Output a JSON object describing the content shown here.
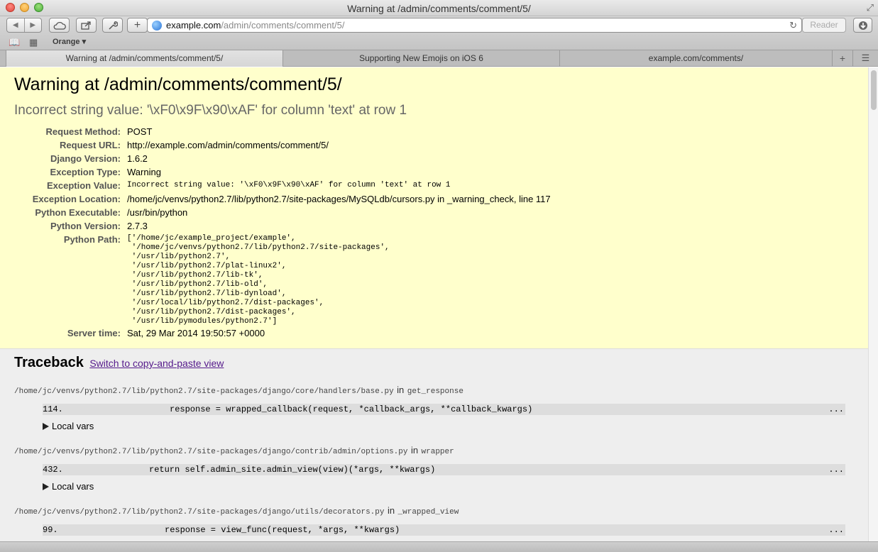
{
  "window": {
    "title": "Warning at /admin/comments/comment/5/"
  },
  "toolbar": {
    "url_host": "example.com",
    "url_path": "/admin/comments/comment/5/",
    "reader_label": "Reader"
  },
  "bookmarks": {
    "folder_label": "Orange ▾"
  },
  "tabs": [
    {
      "label": "Warning at /admin/comments/comment/5/",
      "active": true
    },
    {
      "label": "Supporting New Emojis on iOS 6",
      "active": false
    },
    {
      "label": "example.com/comments/",
      "active": false
    }
  ],
  "summary": {
    "title": "Warning at /admin/comments/comment/5/",
    "subtitle": "Incorrect string value: '\\xF0\\x9F\\x90\\xAF' for column 'text' at row 1",
    "rows": [
      {
        "label": "Request Method:",
        "value": "POST"
      },
      {
        "label": "Request URL:",
        "value": "http://example.com/admin/comments/comment/5/"
      },
      {
        "label": "Django Version:",
        "value": "1.6.2"
      },
      {
        "label": "Exception Type:",
        "value": "Warning"
      },
      {
        "label": "Exception Value:",
        "value": "Incorrect string value: '\\xF0\\x9F\\x90\\xAF' for column 'text' at row 1"
      },
      {
        "label": "Exception Location:",
        "value": "/home/jc/venvs/python2.7/lib/python2.7/site-packages/MySQLdb/cursors.py in _warning_check, line 117"
      },
      {
        "label": "Python Executable:",
        "value": "/usr/bin/python"
      },
      {
        "label": "Python Version:",
        "value": "2.7.3"
      }
    ],
    "python_path_label": "Python Path:",
    "python_path": [
      "['/home/jc/example_project/example',",
      " '/home/jc/venvs/python2.7/lib/python2.7/site-packages',",
      " '/usr/lib/python2.7',",
      " '/usr/lib/python2.7/plat-linux2',",
      " '/usr/lib/python2.7/lib-tk',",
      " '/usr/lib/python2.7/lib-old',",
      " '/usr/lib/python2.7/lib-dynload',",
      " '/usr/local/lib/python2.7/dist-packages',",
      " '/usr/lib/python2.7/dist-packages',",
      " '/usr/lib/pymodules/python2.7']"
    ],
    "server_time_label": "Server time:",
    "server_time": "Sat, 29 Mar 2014 19:50:57 +0000"
  },
  "traceback": {
    "title": "Traceback",
    "switch_link": "Switch to copy-and-paste view",
    "in_word": "in",
    "local_vars_label": "Local vars",
    "ellipsis": "...",
    "frames": [
      {
        "file": "/home/jc/venvs/python2.7/lib/python2.7/site-packages/django/core/handlers/base.py",
        "func": "get_response",
        "lineno": "114.",
        "code": "response = wrapped_callback(request, *callback_args, **callback_kwargs)"
      },
      {
        "file": "/home/jc/venvs/python2.7/lib/python2.7/site-packages/django/contrib/admin/options.py",
        "func": "wrapper",
        "lineno": "432.",
        "code": "return self.admin_site.admin_view(view)(*args, **kwargs)"
      },
      {
        "file": "/home/jc/venvs/python2.7/lib/python2.7/site-packages/django/utils/decorators.py",
        "func": "_wrapped_view",
        "lineno": "99.",
        "code": "response = view_func(request, *args, **kwargs)"
      }
    ]
  }
}
